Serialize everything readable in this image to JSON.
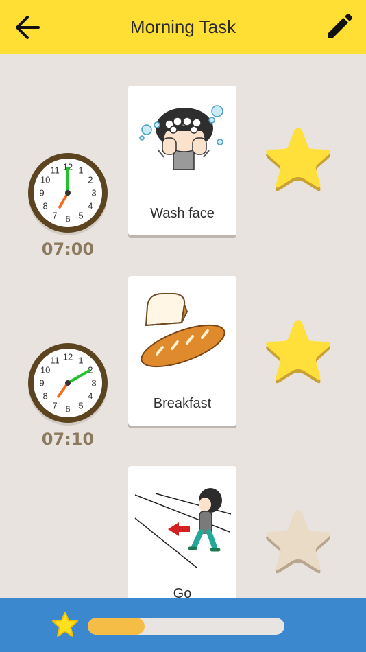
{
  "header": {
    "title": "Morning Task",
    "back_icon": "arrow-left-icon",
    "edit_icon": "pencil-icon"
  },
  "tasks": [
    {
      "time": "07:00",
      "hour": 7,
      "minute": 0,
      "label": "Wash face",
      "picture": "wash-face-icon",
      "done": true
    },
    {
      "time": "07:10",
      "hour": 7,
      "minute": 10,
      "label": "Breakfast",
      "picture": "breakfast-bread-icon",
      "done": true
    },
    {
      "time": "",
      "label": "Go",
      "picture": "go-walking-icon",
      "done": false
    }
  ],
  "clock_numbers": [
    "12",
    "1",
    "2",
    "3",
    "4",
    "5",
    "6",
    "7",
    "8",
    "9",
    "10",
    "11"
  ],
  "footer": {
    "progress": 0.29,
    "star_icon": "star-icon"
  },
  "colors": {
    "header_bg": "#ffdf33",
    "footer_bg": "#3b88cf",
    "background": "#e8e3df",
    "star_done": "#ffe03a",
    "star_pending": "#eadbc6",
    "clock_rim": "#5d4421",
    "minute_hand": "#22c22c",
    "hour_hand": "#f07020",
    "progress_fill": "#f5bd45",
    "time_text": "#8c7a5e"
  }
}
